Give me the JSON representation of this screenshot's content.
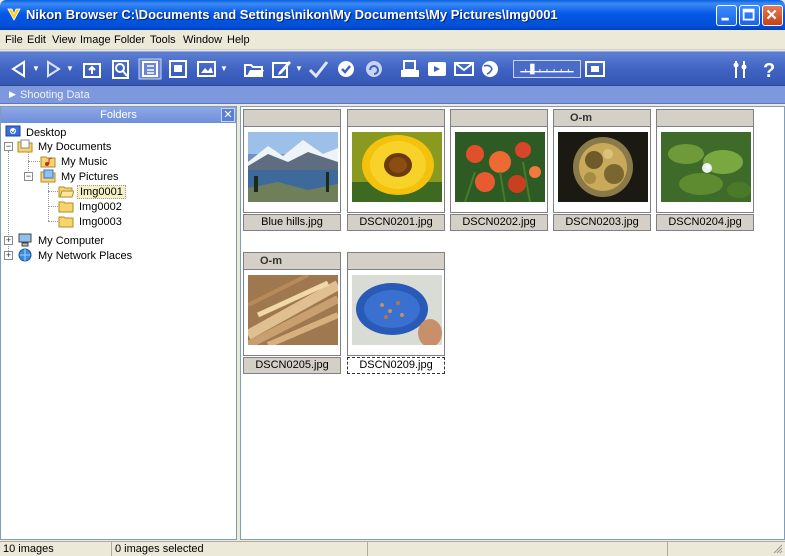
{
  "window": {
    "title": "Nikon Browser C:\\Documents and Settings\\nikon\\My Documents\\My Pictures\\Img0001"
  },
  "menu": [
    "File",
    "Edit",
    "View",
    "Image",
    "Folder",
    "Tools",
    "Window",
    "Help"
  ],
  "toolbar": {
    "icons": [
      "back-icon",
      "forward-icon",
      "up-folder-icon",
      "search-icon",
      "folders-view-icon",
      "preview-icon",
      "slideshow-icon",
      "open-icon",
      "edit-icon",
      "check-icon",
      "confirm-icon",
      "rotate-icon",
      "print-icon",
      "transfer-icon",
      "email-icon",
      "web-icon",
      "size-slider",
      "thumbnail-size-icon",
      "tools-icon",
      "help-icon"
    ]
  },
  "shooting_data": {
    "label": "Shooting Data"
  },
  "folders_panel": {
    "header": "Folders",
    "tree": [
      {
        "label": "Desktop",
        "icon": "desktop-icon"
      },
      {
        "label": "My Documents",
        "icon": "documents-folder-icon"
      },
      {
        "label": "My Music",
        "icon": "music-folder-icon"
      },
      {
        "label": "My Pictures",
        "icon": "pictures-folder-icon"
      },
      {
        "label": "Img0001",
        "icon": "folder-open-icon",
        "selected": true
      },
      {
        "label": "Img0002",
        "icon": "folder-icon"
      },
      {
        "label": "Img0003",
        "icon": "folder-icon"
      },
      {
        "label": "My Computer",
        "icon": "computer-icon"
      },
      {
        "label": "My Network Places",
        "icon": "network-icon"
      }
    ]
  },
  "thumbnails": [
    {
      "name": "Blue hills.jpg",
      "protected": false
    },
    {
      "name": "DSCN0201.jpg",
      "protected": false
    },
    {
      "name": "DSCN0202.jpg",
      "protected": false
    },
    {
      "name": "DSCN0203.jpg",
      "protected": true
    },
    {
      "name": "DSCN0204.jpg",
      "protected": false
    },
    {
      "name": "DSCN0205.jpg",
      "protected": true
    },
    {
      "name": "DSCN0209.jpg",
      "protected": false,
      "focused": true
    }
  ],
  "protect_glyph": "O-m",
  "status": {
    "count": "10 images",
    "selected": "0 images selected"
  }
}
